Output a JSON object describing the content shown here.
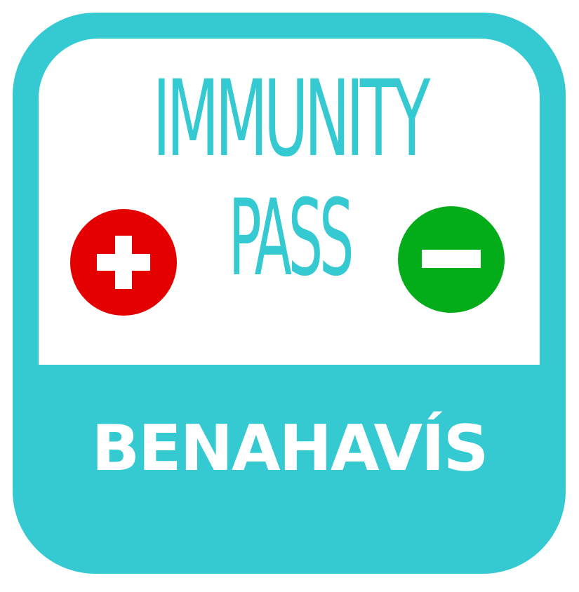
{
  "logo": {
    "line1": "IMMUNITY",
    "line2": "PASS",
    "place": "BENAHAVÍS"
  },
  "icons": {
    "positive": "plus-circle-icon",
    "negative": "minus-circle-icon"
  },
  "colors": {
    "brand_teal": "#35c9d1",
    "panel_white": "#ffffff",
    "positive_red": "#e40000",
    "negative_green": "#03ad1a"
  }
}
